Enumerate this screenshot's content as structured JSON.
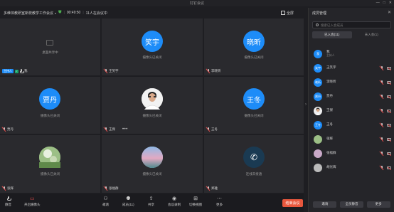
{
  "window": {
    "title": "钉钉会议"
  },
  "infobar": {
    "meeting_title": "多维体教研室新校教学工作会议",
    "duration": "00:49:50",
    "attendee_count": "11人在会议中",
    "fullscreen_label": "全屏"
  },
  "tiles": [
    {
      "id": "t1",
      "name": "我",
      "status": "桌面共享中",
      "host_badge": "主持人"
    },
    {
      "id": "t2",
      "avatar": "笑宇",
      "name": "王笑宇",
      "status": "摄像头已关闭"
    },
    {
      "id": "t3",
      "avatar": "晓昕",
      "name": "李晓昕",
      "status": "摄像头已关闭"
    },
    {
      "id": "t4",
      "avatar": "贾丹",
      "name": "贾丹",
      "status": "摄像头已关闭"
    },
    {
      "id": "t5",
      "name": "王保",
      "status": "摄像头已关闭",
      "more": "•••"
    },
    {
      "id": "t6",
      "avatar": "王冬",
      "name": "王冬",
      "status": "摄像头已关闭"
    },
    {
      "id": "t7",
      "name": "张辉",
      "status": "摄像头已关闭"
    },
    {
      "id": "t8",
      "name": "张福群",
      "status": "摄像头已关闭"
    },
    {
      "id": "t9",
      "name": "郑雅",
      "status": "连线未接通"
    }
  ],
  "toolbar": {
    "mute": "静音",
    "camera": "开启摄像头",
    "invite": "邀请",
    "members": "成员(11)",
    "share": "共享",
    "record": "会议录制",
    "layout": "切换视图",
    "more": "更多",
    "end": "结束会议"
  },
  "panel": {
    "title": "成员管理",
    "search_placeholder": "搜索已入会成员",
    "tab_joined": "已入会(11)",
    "tab_not_joined": "未入会(1)",
    "members": [
      {
        "avatar": "我",
        "name": "我",
        "sub": "主持人"
      },
      {
        "avatar": "笑宇",
        "name": "王笑宇"
      },
      {
        "avatar": "晓昕",
        "name": "李晓昕"
      },
      {
        "avatar": "贾丹",
        "name": "贾丹"
      },
      {
        "avatar": "",
        "name": "王保"
      },
      {
        "avatar": "王冬",
        "name": "王冬"
      },
      {
        "avatar": "",
        "name": "张辉"
      },
      {
        "avatar": "",
        "name": "张福群"
      },
      {
        "avatar": "",
        "name": "胡光辉"
      }
    ],
    "invite": "邀请",
    "mute_all": "全员静音",
    "more": "更多"
  },
  "colors": {
    "accent": "#1d8cf8",
    "end": "#e8573d",
    "bg": "#1e1e22",
    "tile": "#2a2a2e"
  }
}
